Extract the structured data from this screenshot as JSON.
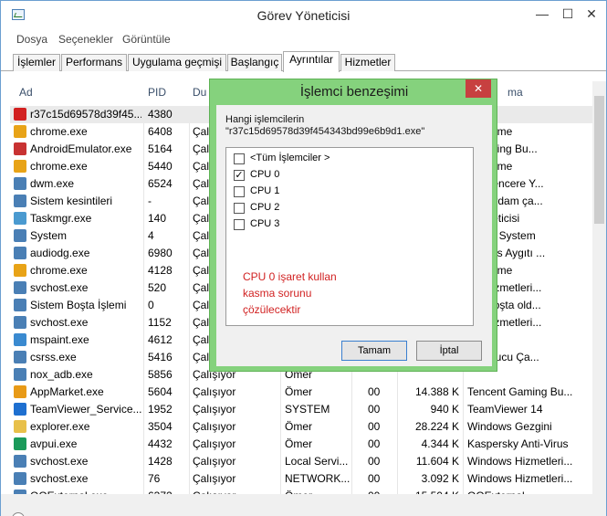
{
  "window": {
    "title": "Görev Yöneticisi"
  },
  "menu": [
    "Dosya",
    "Seçenekler",
    "Görüntüle"
  ],
  "tabs": [
    "İşlemler",
    "Performans",
    "Uygulama geçmişi",
    "Başlangıç",
    "Ayrıntılar",
    "Hizmetler"
  ],
  "active_tab": "Ayrıntılar",
  "columns": {
    "name": "Ad",
    "pid": "PID",
    "status": "Du",
    "description": "ma"
  },
  "rows": [
    {
      "name": "r37c15d69578d39f45...",
      "pid": "4380",
      "status": "",
      "user": "",
      "cpu": "",
      "mem": "",
      "desc": "",
      "icon_color": "#d22020"
    },
    {
      "name": "chrome.exe",
      "pid": "6408",
      "status": "Çal",
      "user": "",
      "cpu": "",
      "mem": "",
      "desc": "t Chrome",
      "icon_color": "#e8a317"
    },
    {
      "name": "AndroidEmulator.exe",
      "pid": "5164",
      "status": "Çal",
      "user": "",
      "cpu": "",
      "mem": "",
      "desc": "t Gaming Bu...",
      "icon_color": "#c83232"
    },
    {
      "name": "chrome.exe",
      "pid": "5440",
      "status": "Çal",
      "user": "",
      "cpu": "",
      "mem": "",
      "desc": "t Chrome",
      "icon_color": "#e8a317"
    },
    {
      "name": "dwm.exe",
      "pid": "6524",
      "status": "Çal",
      "user": "",
      "cpu": "",
      "mem": "",
      "desc": "stü Pencere Y...",
      "icon_color": "#4a7fb5"
    },
    {
      "name": "Sistem kesintileri",
      "pid": "-",
      "status": "Çal",
      "user": "",
      "cpu": "",
      "mem": "",
      "desc": "en yordam ça...",
      "icon_color": "#4a7fb5"
    },
    {
      "name": "Taskmgr.exe",
      "pid": "140",
      "status": "Çal",
      "user": "",
      "cpu": "",
      "mem": "",
      "desc": "i Yöneticisi",
      "icon_color": "#4a9ad0"
    },
    {
      "name": "System",
      "pid": "4",
      "status": "Çal",
      "user": "",
      "cpu": "",
      "mem": "",
      "desc": "rnel & System",
      "icon_color": "#4a7fb5"
    },
    {
      "name": "audiodg.exe",
      "pid": "6980",
      "status": "Çal",
      "user": "",
      "cpu": "",
      "mem": "",
      "desc": "ws Ses Aygıtı ...",
      "icon_color": "#4a7fb5"
    },
    {
      "name": "chrome.exe",
      "pid": "4128",
      "status": "Çal",
      "user": "",
      "cpu": "",
      "mem": "",
      "desc": "t Chrome",
      "icon_color": "#e8a317"
    },
    {
      "name": "svchost.exe",
      "pid": "520",
      "status": "Çal",
      "user": "",
      "cpu": "",
      "mem": "",
      "desc": "ws Hizmetleri...",
      "icon_color": "#4a7fb5"
    },
    {
      "name": "Sistem Boşta İşlemi",
      "pid": "0",
      "status": "Çal",
      "user": "",
      "cpu": "",
      "mem": "",
      "desc": "inin boşta old...",
      "icon_color": "#4a7fb5"
    },
    {
      "name": "svchost.exe",
      "pid": "1152",
      "status": "Çal",
      "user": "",
      "cpu": "",
      "mem": "",
      "desc": "ws Hizmetleri...",
      "icon_color": "#4a7fb5"
    },
    {
      "name": "mspaint.exe",
      "pid": "4612",
      "status": "Çal",
      "user": "",
      "cpu": "",
      "mem": "",
      "desc": "",
      "icon_color": "#3a8ad0"
    },
    {
      "name": "csrss.exe",
      "pid": "5416",
      "status": "Çal",
      "user": "",
      "cpu": "",
      "mem": "",
      "desc": "ıi Sunucu Ça...",
      "icon_color": "#4a7fb5"
    },
    {
      "name": "nox_adb.exe",
      "pid": "5856",
      "status": "Çalışıyor",
      "user": "Ömer",
      "cpu": "",
      "mem": "",
      "desc": "",
      "icon_color": "#4a7fb5"
    },
    {
      "name": "AppMarket.exe",
      "pid": "5604",
      "status": "Çalışıyor",
      "user": "Ömer",
      "cpu": "00",
      "mem": "14.388 K",
      "desc": "Tencent Gaming Bu...",
      "icon_color": "#e89a17"
    },
    {
      "name": "TeamViewer_Service....",
      "pid": "1952",
      "status": "Çalışıyor",
      "user": "SYSTEM",
      "cpu": "00",
      "mem": "940 K",
      "desc": "TeamViewer 14",
      "icon_color": "#1e6fd0"
    },
    {
      "name": "explorer.exe",
      "pid": "3504",
      "status": "Çalışıyor",
      "user": "Ömer",
      "cpu": "00",
      "mem": "28.224 K",
      "desc": "Windows Gezgini",
      "icon_color": "#e8c04a"
    },
    {
      "name": "avpui.exe",
      "pid": "4432",
      "status": "Çalışıyor",
      "user": "Ömer",
      "cpu": "00",
      "mem": "4.344 K",
      "desc": "Kaspersky Anti-Virus",
      "icon_color": "#1a9a5a"
    },
    {
      "name": "svchost.exe",
      "pid": "1428",
      "status": "Çalışıyor",
      "user": "Local Servi...",
      "cpu": "00",
      "mem": "11.604 K",
      "desc": "Windows Hizmetleri...",
      "icon_color": "#4a7fb5"
    },
    {
      "name": "svchost.exe",
      "pid": "76",
      "status": "Çalışıyor",
      "user": "NETWORK...",
      "cpu": "00",
      "mem": "3.092 K",
      "desc": "Windows Hizmetleri...",
      "icon_color": "#4a7fb5"
    },
    {
      "name": "QQExternal.exe",
      "pid": "6372",
      "status": "Çalışıyor",
      "user": "Ömer",
      "cpu": "00",
      "mem": "15.504 K",
      "desc": "QQExternal",
      "icon_color": "#4a7fb5"
    }
  ],
  "dialog": {
    "title": "İşlemci benzeşimi",
    "close_label": "✕",
    "prompt": "Hangi işlemcilerin",
    "process": "\"r37c15d69578d39f454343bd99e6b9d1.exe\"",
    "cpus": [
      {
        "label": "<Tüm İşlemciler >",
        "checked": false
      },
      {
        "label": "CPU 0",
        "checked": true
      },
      {
        "label": "CPU 1",
        "checked": false
      },
      {
        "label": "CPU 2",
        "checked": false
      },
      {
        "label": "CPU 3",
        "checked": false
      }
    ],
    "note": "CPU 0 işaret kullan kasma sorunu çözülecektir",
    "ok_label": "Tamam",
    "cancel_label": "İptal"
  }
}
